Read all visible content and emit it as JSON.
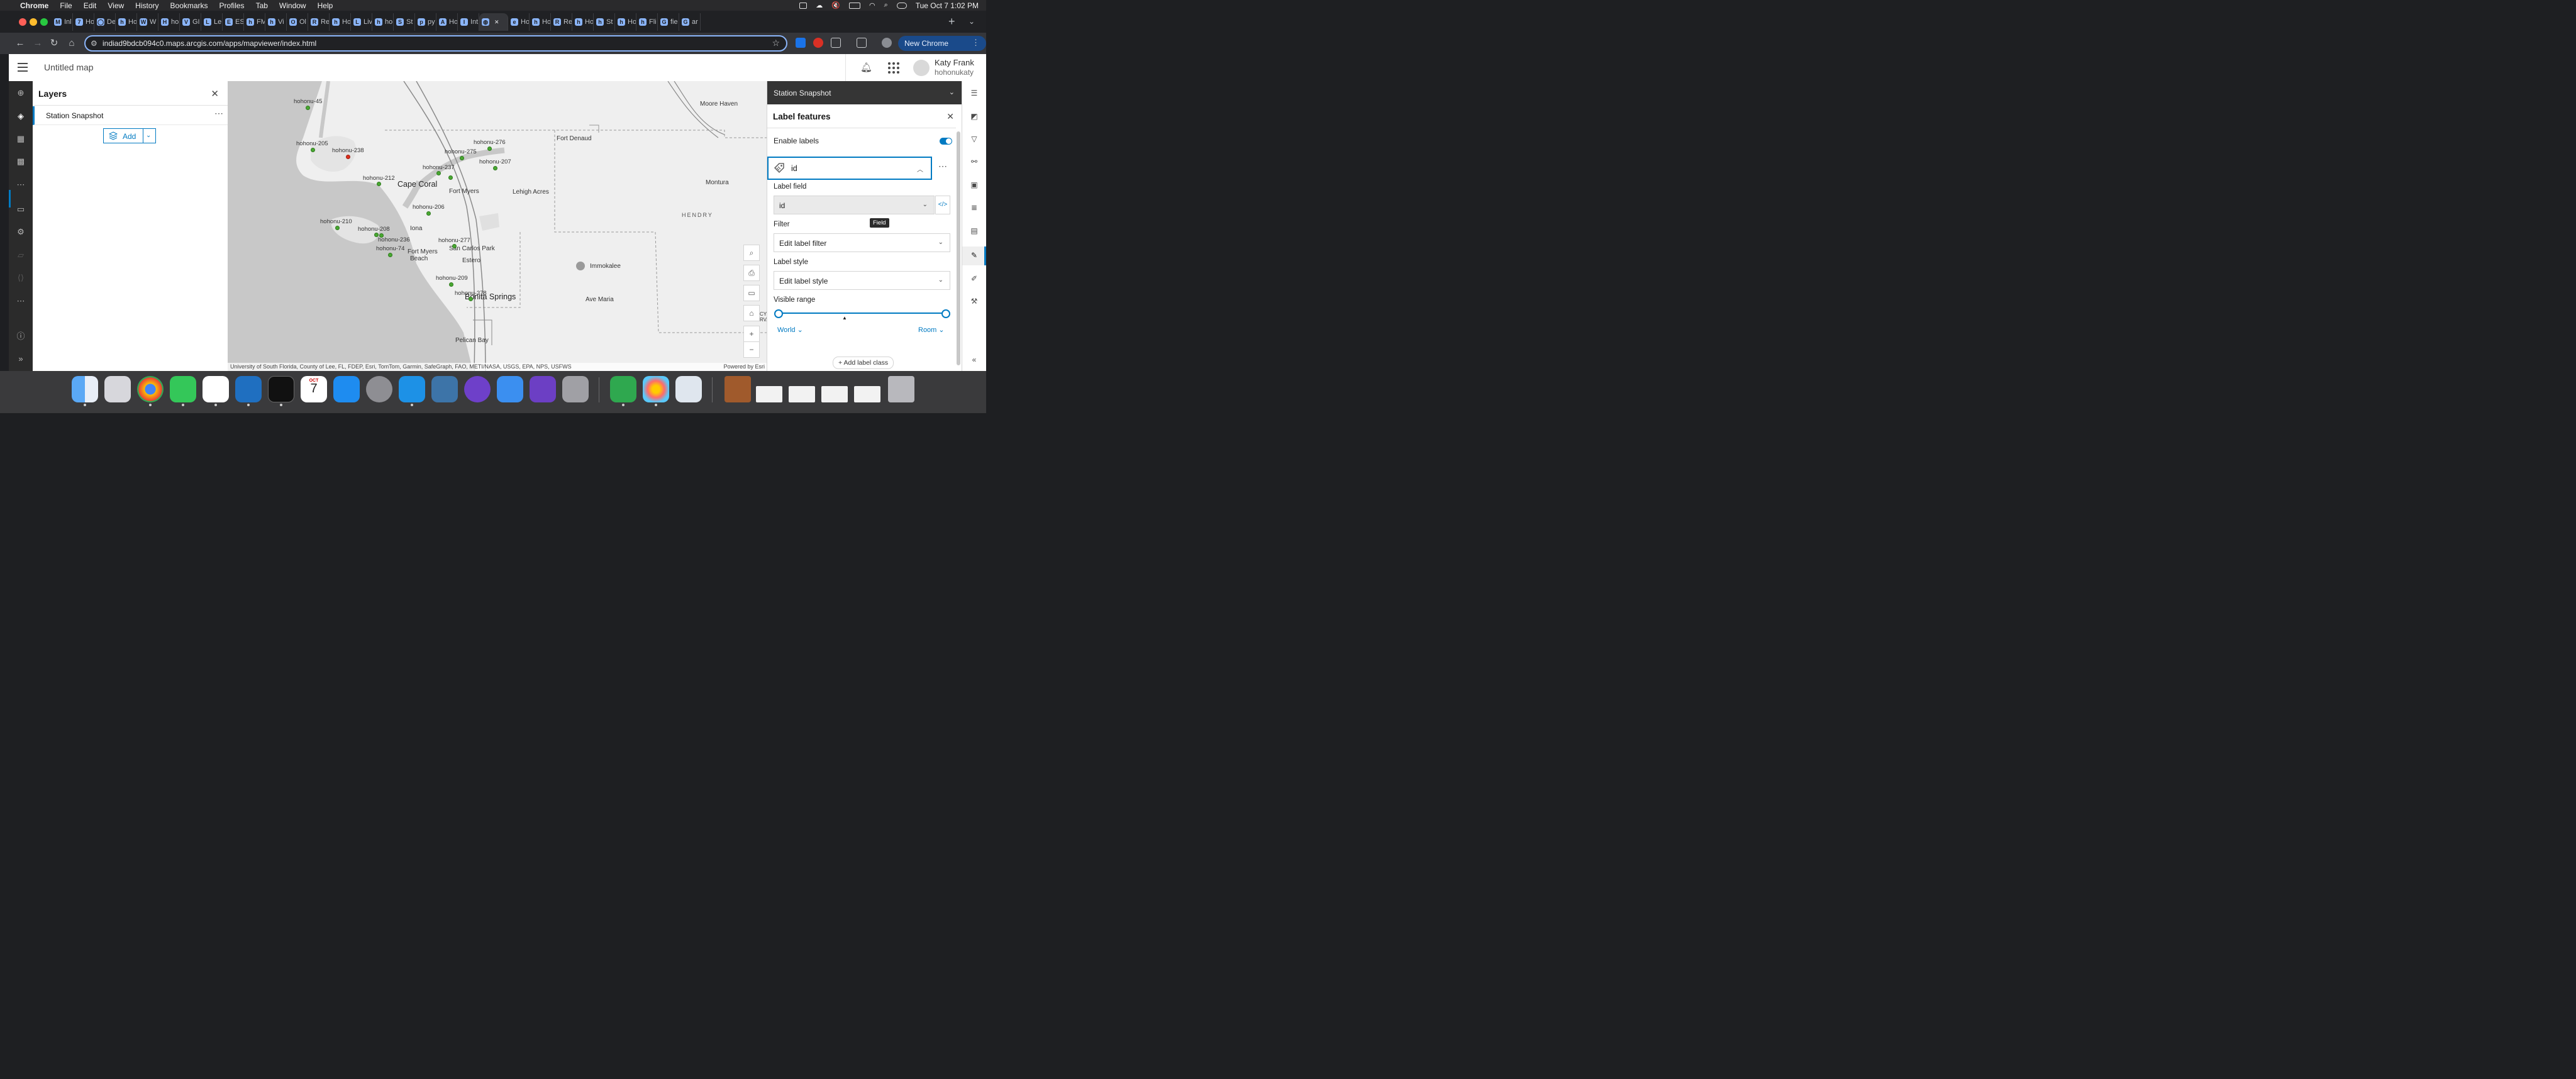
{
  "menubar": {
    "app": "Chrome",
    "items": [
      "File",
      "Edit",
      "View",
      "History",
      "Bookmarks",
      "Profiles",
      "Tab",
      "Window",
      "Help"
    ],
    "clock": "Tue Oct 7  1:02 PM"
  },
  "browser": {
    "tabs": [
      {
        "fav": "M",
        "label": "Inl"
      },
      {
        "fav": "7",
        "label": "Ho"
      },
      {
        "fav": "◯",
        "label": "De"
      },
      {
        "fav": "h",
        "label": "Ho"
      },
      {
        "fav": "W",
        "label": "W"
      },
      {
        "fav": "H",
        "label": "ho"
      },
      {
        "fav": "V",
        "label": "GI"
      },
      {
        "fav": "L",
        "label": "Le"
      },
      {
        "fav": "E",
        "label": "ES"
      },
      {
        "fav": "h",
        "label": "FM"
      },
      {
        "fav": "h",
        "label": "Vi"
      },
      {
        "fav": "O",
        "label": "Ol"
      },
      {
        "fav": "R",
        "label": "Re"
      },
      {
        "fav": "h",
        "label": "Ho"
      },
      {
        "fav": "L",
        "label": "Liv"
      },
      {
        "fav": "h",
        "label": "ho"
      },
      {
        "fav": "S",
        "label": "St"
      },
      {
        "fav": "p",
        "label": "py"
      },
      {
        "fav": "A",
        "label": "Ho"
      },
      {
        "fav": "I",
        "label": "Int"
      },
      {
        "fav": "◍",
        "label": ""
      },
      {
        "fav": "e",
        "label": "Ho"
      },
      {
        "fav": "h",
        "label": "Ho"
      },
      {
        "fav": "R",
        "label": "Re"
      },
      {
        "fav": "h",
        "label": "Ho"
      },
      {
        "fav": "h",
        "label": "St"
      },
      {
        "fav": "h",
        "label": "Ho"
      },
      {
        "fav": "h",
        "label": "Fli"
      },
      {
        "fav": "G",
        "label": "fie"
      },
      {
        "fav": "G",
        "label": "ar"
      }
    ],
    "active_tab_index": 20,
    "url": "indiad9bdcb094c0.maps.arcgis.com/apps/mapviewer/index.html",
    "new_chrome": "New Chrome available"
  },
  "header": {
    "map_title": "Untitled map",
    "user_name": "Katy Frank",
    "user_handle": "hohonukaty"
  },
  "layers_panel": {
    "title": "Layers",
    "layer_name": "Station Snapshot",
    "add_label": "Add"
  },
  "map": {
    "stations": [
      {
        "id": "hohonu-45",
        "color": "#49a832"
      },
      {
        "id": "hohonu-205",
        "color": "#49a832"
      },
      {
        "id": "hohonu-238",
        "color": "#e0301e"
      },
      {
        "id": "hohonu-212",
        "color": "#49a832"
      },
      {
        "id": "hohonu-275",
        "color": "#49a832"
      },
      {
        "id": "hohonu-276",
        "color": "#49a832"
      },
      {
        "id": "hohonu-237",
        "color": "#49a832"
      },
      {
        "id": "hohonu-207",
        "color": "#49a832"
      },
      {
        "id": "hohonu-206",
        "color": "#49a832"
      },
      {
        "id": "hohonu-210",
        "color": "#49a832"
      },
      {
        "id": "hohonu-208",
        "color": "#49a832"
      },
      {
        "id": "hohonu-236",
        "color": "#49a832"
      },
      {
        "id": "hohonu-74",
        "color": "#49a832"
      },
      {
        "id": "hohonu-277",
        "color": "#49a832"
      },
      {
        "id": "hohonu-209",
        "color": "#49a832"
      },
      {
        "id": "hohonu-278",
        "color": "#49a832"
      }
    ],
    "places": {
      "moore_haven": "Moore Haven",
      "fort_denaud": "Fort Denaud",
      "montura": "Montura",
      "cape_coral": "Cape Coral",
      "fort_myers": "Fort Myers",
      "lehigh_acres": "Lehigh Acres",
      "hendry": "HENDRY",
      "iona": "Iona",
      "san_carlos_park": "San Carlos Park",
      "fort_myers_beach_1": "Fort Myers",
      "fort_myers_beach_2": "Beach",
      "estero": "Estero",
      "immokalee": "Immokalee",
      "bonita_springs": "Bonita Springs",
      "ave_maria": "Ave Maria",
      "pelican_bay": "Pelican Bay",
      "edge_1": "CYP",
      "edge_2": "RVA"
    },
    "attribution": "University of South Florida, County of Lee, FL, FDEP, Esri, TomTom, Garmin, SafeGraph, FAO, METI/NASA, USGS, EPA, NPS, USFWS",
    "powered_by": "Powered by Esri"
  },
  "right_panel": {
    "layer_selector": "Station Snapshot",
    "title": "Label features",
    "enable_labels": "Enable labels",
    "enable_labels_on": true,
    "label_class": "id",
    "label_field_title": "Label field",
    "label_field_value": "id",
    "tooltip": "Field",
    "filter_title": "Filter",
    "filter_value": "Edit label filter",
    "style_title": "Label style",
    "style_value": "Edit label style",
    "range_title": "Visible range",
    "range_min": "World",
    "range_max": "Room",
    "add_label_class": "Add label class"
  },
  "colors": {
    "accent": "#007ac2",
    "station_ok": "#49a832",
    "station_alert": "#e0301e"
  }
}
